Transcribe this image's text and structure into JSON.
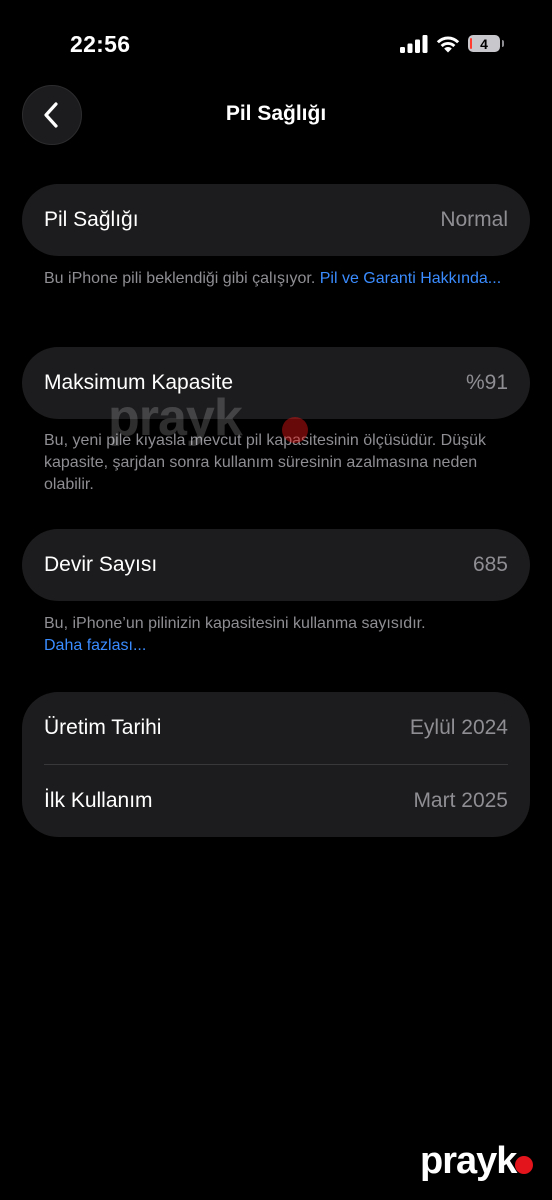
{
  "status_bar": {
    "time": "22:56",
    "battery_level": "4",
    "icons": [
      "signal-icon",
      "wifi-icon",
      "battery-icon"
    ]
  },
  "nav": {
    "title": "Pil Sağlığı",
    "back_icon": "chevron-left-icon"
  },
  "sections": {
    "health": {
      "label": "Pil Sağlığı",
      "value": "Normal",
      "footnote_text": "Bu iPhone pili beklendiği gibi çalışıyor. ",
      "footnote_link": "Pil ve Garanti Hakkında..."
    },
    "capacity": {
      "label": "Maksimum Kapasite",
      "value": "%91",
      "footnote_text": "Bu, yeni pile kıyasla mevcut pil kapasitesinin ölçüsüdür. Düşük kapasite, şarjdan sonra kullanım süresinin azalmasına neden olabilir."
    },
    "cycles": {
      "label": "Devir Sayısı",
      "value": "685",
      "footnote_text": "Bu, iPhone’un pilinizin kapasitesini kullanma sayısıdır.",
      "footnote_link": "Daha fazlası..."
    },
    "dates": {
      "manufacture_label": "Üretim Tarihi",
      "manufacture_value": "Eylül 2024",
      "first_use_label": "İlk Kullanım",
      "first_use_value": "Mart 2025"
    }
  },
  "watermark": {
    "text": "prayk"
  },
  "colors": {
    "background": "#000000",
    "card": "#1c1c1e",
    "secondary_text": "#8e8e93",
    "link": "#3a8cff",
    "battery_low": "#ff3b30",
    "watermark_dot": "#e3141b"
  }
}
